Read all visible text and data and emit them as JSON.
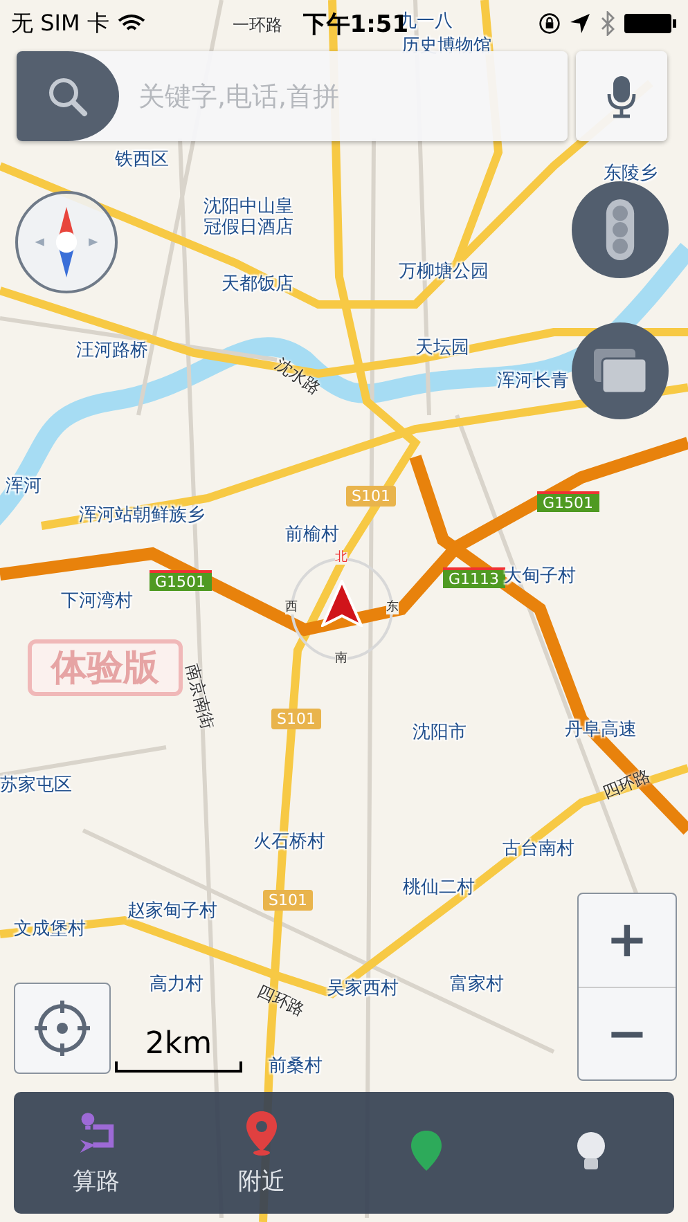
{
  "status_bar": {
    "carrier": "无 SIM 卡",
    "time": "下午1:51"
  },
  "search": {
    "placeholder": "关键字,电话,首拼"
  },
  "map": {
    "labels": [
      {
        "kind": "road",
        "text": "一环路"
      },
      {
        "kind": "place",
        "text": "九一八"
      },
      {
        "kind": "place",
        "text": "历史博物馆"
      },
      {
        "kind": "place",
        "text": "铁西区"
      },
      {
        "kind": "place",
        "text": "沈阳中山皇冠假日酒店"
      },
      {
        "kind": "place",
        "text": "天都饭店"
      },
      {
        "kind": "place",
        "text": "万柳塘公园"
      },
      {
        "kind": "place",
        "text": "东陵乡"
      },
      {
        "kind": "place",
        "text": "汪河路桥"
      },
      {
        "kind": "road",
        "text": "沈水路"
      },
      {
        "kind": "place",
        "text": "天坛园"
      },
      {
        "kind": "place",
        "text": "浑河长青"
      },
      {
        "kind": "place",
        "text": "浑河"
      },
      {
        "kind": "place",
        "text": "浑河站朝鲜族乡"
      },
      {
        "kind": "highway",
        "text": "S101"
      },
      {
        "kind": "place",
        "text": "前榆村"
      },
      {
        "kind": "expressway",
        "text": "G1501"
      },
      {
        "kind": "place",
        "text": "下河湾村"
      },
      {
        "kind": "expressway",
        "text": "G1501"
      },
      {
        "kind": "expressway",
        "text": "G1113"
      },
      {
        "kind": "place",
        "text": "大甸子村"
      },
      {
        "kind": "stamp",
        "text": "体验版"
      },
      {
        "kind": "road",
        "text": "南京南街"
      },
      {
        "kind": "highway",
        "text": "S101"
      },
      {
        "kind": "place",
        "text": "沈阳市"
      },
      {
        "kind": "place",
        "text": "丹阜高速"
      },
      {
        "kind": "place",
        "text": "苏家屯区"
      },
      {
        "kind": "road",
        "text": "四环路"
      },
      {
        "kind": "place",
        "text": "火石桥村"
      },
      {
        "kind": "place",
        "text": "古台南村"
      },
      {
        "kind": "place",
        "text": "桃仙二村"
      },
      {
        "kind": "place",
        "text": "赵家甸子村"
      },
      {
        "kind": "highway",
        "text": "S101"
      },
      {
        "kind": "place",
        "text": "文成堡村"
      },
      {
        "kind": "place",
        "text": "高力村"
      },
      {
        "kind": "road",
        "text": "四环路"
      },
      {
        "kind": "place",
        "text": "吴家西村"
      },
      {
        "kind": "place",
        "text": "富家村"
      },
      {
        "kind": "place",
        "text": "前桑村"
      }
    ],
    "locator": {
      "north": "北",
      "west": "西",
      "east": "东",
      "south": "南"
    },
    "scale": "2km"
  },
  "zoom": {
    "plus": "+",
    "minus": "−"
  },
  "bottom_bar": [
    {
      "kind": "route",
      "label": "算路"
    },
    {
      "kind": "nearby",
      "label": "附近"
    },
    {
      "kind": "pin"
    },
    {
      "kind": "bulb"
    }
  ]
}
